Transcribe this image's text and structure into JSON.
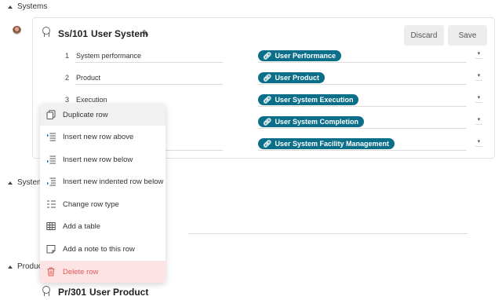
{
  "sections": {
    "systems": "Systems",
    "systems2": "System",
    "product": "Product"
  },
  "card": {
    "id": "Ss/101",
    "title": "User System",
    "discard_label": "Discard",
    "save_label": "Save",
    "rows": [
      {
        "num": "1",
        "label": "System performance",
        "tag": "User Performance"
      },
      {
        "num": "2",
        "label": "Product",
        "tag": "User Product"
      },
      {
        "num": "3",
        "label": "Execution",
        "tag": "User System Execution"
      },
      {
        "num": "",
        "label": "",
        "tag": "User System Completion"
      },
      {
        "num": "",
        "label": "",
        "tag": "User System Facility Management"
      }
    ]
  },
  "product_card": {
    "id": "Pr/301",
    "title": "User Product"
  },
  "context_menu": {
    "items": [
      {
        "label": "Duplicate row",
        "icon": "duplicate-icon"
      },
      {
        "label": "Insert new row above",
        "icon": "insert-above-icon"
      },
      {
        "label": "Insert new row below",
        "icon": "insert-below-icon"
      },
      {
        "label": "Insert new indented row below",
        "icon": "insert-indented-icon"
      },
      {
        "label": "Change row type",
        "icon": "change-type-icon"
      },
      {
        "label": "Add a table",
        "icon": "table-icon"
      },
      {
        "label": "Add a note to this row",
        "icon": "note-icon"
      },
      {
        "label": "Delete row",
        "icon": "trash-icon"
      }
    ]
  },
  "colors": {
    "tag": "#0b6f8a",
    "danger": "#e05b5b",
    "danger_bg": "#fde3e3"
  }
}
